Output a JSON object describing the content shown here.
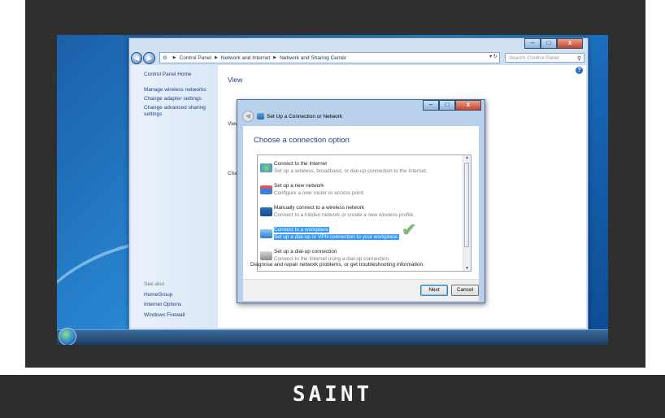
{
  "window": {
    "breadcrumb": [
      "Control Panel",
      "Network and Internet",
      "Network and Sharing Center"
    ],
    "search_placeholder": "Search Control Panel",
    "caption": {
      "minimize": "–",
      "maximize": "□",
      "close": "x"
    }
  },
  "sidebar": {
    "items": [
      "Control Panel Home",
      "Manage wireless networks",
      "Change adapter settings",
      "Change advanced sharing",
      "settings"
    ],
    "see_also_label": "See also",
    "see_also": [
      "HomeGroup",
      "Internet Options",
      "Windows Firewall"
    ]
  },
  "main": {
    "heading_fragment": "View your basic network information and set up connections",
    "view_fragment": "View",
    "change_fragment": "Chang",
    "troubleshoot_text": "Diagnose and repair network problems, or get troubleshooting information."
  },
  "dialog": {
    "title": "Set Up a Connection or Network",
    "heading": "Choose a connection option",
    "options": [
      {
        "title": "Connect to the Internet",
        "desc": "Set up a wireless, broadband, or dial-up connection to the Internet.",
        "icon": "globe-network-icon",
        "color": "#2f8fe0"
      },
      {
        "title": "Set up a new network",
        "desc": "Configure a new router or access point.",
        "icon": "router-icon",
        "color": "#3d7fd0"
      },
      {
        "title": "Manually connect to a wireless network",
        "desc": "Connect to a hidden network or create a new wireless profile.",
        "icon": "wireless-monitor-icon",
        "color": "#2b6cb8"
      },
      {
        "title": "Connect to a workplace",
        "desc": "Set up a dial-up or VPN connection to your workplace.",
        "icon": "workplace-icon",
        "color": "#4aa0e8",
        "selected": true
      },
      {
        "title": "Set up a dial-up connection",
        "desc": "Connect to the Internet using a dial-up connection.",
        "icon": "phone-modem-icon",
        "color": "#8a8a8a"
      }
    ],
    "next_label": "Next",
    "cancel_label": "Cancel",
    "check_glyph": "✔"
  },
  "brand": {
    "logo_text": "SAINT"
  }
}
